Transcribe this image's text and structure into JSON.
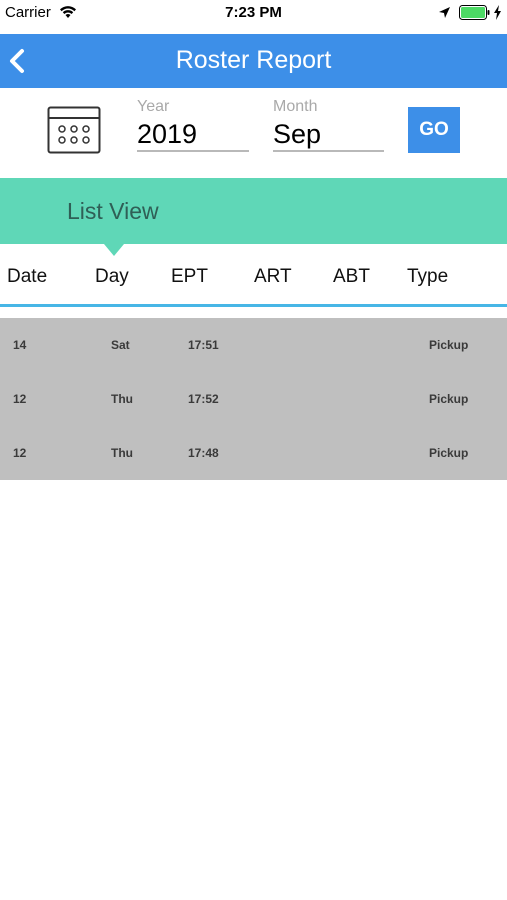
{
  "status_bar": {
    "carrier": "Carrier",
    "time": "7:23 PM",
    "icons": [
      "wifi-icon",
      "location-arrow-icon",
      "battery-icon",
      "charging-bolt-icon"
    ],
    "battery_color": "#4cd964"
  },
  "nav": {
    "title": "Roster Report",
    "back_icon": "chevron-left-icon",
    "bg_color": "#3d8fe8"
  },
  "filters": {
    "calendar_icon": "calendar-icon",
    "year": {
      "label": "Year",
      "value": "2019"
    },
    "month": {
      "label": "Month",
      "value": "Sep"
    },
    "go_label": "GO"
  },
  "list_view": {
    "title": "List View",
    "bg_color": "#5fd7b7"
  },
  "table": {
    "columns": [
      "Date",
      "Day",
      "EPT",
      "ART",
      "ABT",
      "Type"
    ],
    "rows": [
      {
        "date": "14",
        "day": "Sat",
        "ept": "17:51",
        "art": "",
        "abt": "",
        "type": "Pickup"
      },
      {
        "date": "12",
        "day": "Thu",
        "ept": "17:52",
        "art": "",
        "abt": "",
        "type": "Pickup"
      },
      {
        "date": "12",
        "day": "Thu",
        "ept": "17:48",
        "art": "",
        "abt": "",
        "type": "Pickup"
      }
    ]
  }
}
